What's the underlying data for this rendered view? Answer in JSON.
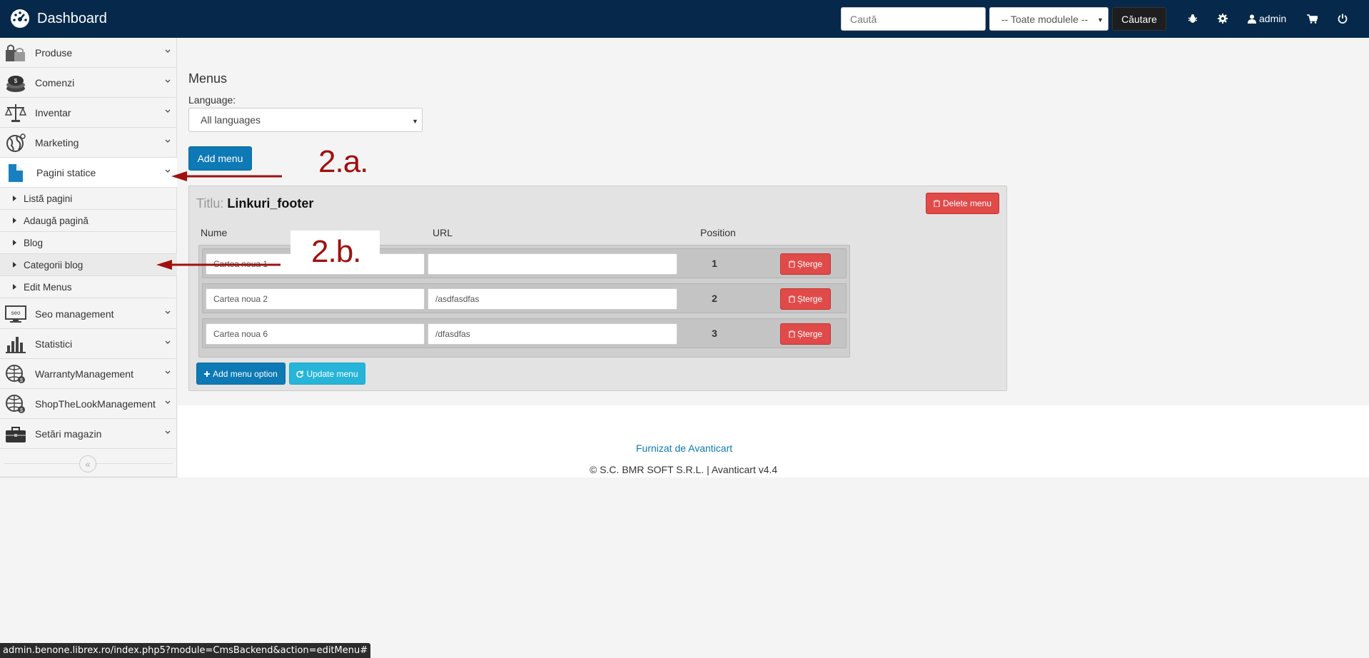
{
  "navbar": {
    "brand": "Dashboard",
    "search_placeholder": "Caută",
    "module_select": "-- Toate modulele --",
    "search_button": "Căutare",
    "user": "admin",
    "icons": [
      "bug-icon",
      "gear-icon",
      "user-icon",
      "cart-icon",
      "power-icon"
    ]
  },
  "sidebar": {
    "items": [
      {
        "label": "Produse",
        "icon": "shopping-bags-icon"
      },
      {
        "label": "Comenzi",
        "icon": "coins-icon"
      },
      {
        "label": "Inventar",
        "icon": "scale-icon"
      },
      {
        "label": "Marketing",
        "icon": "globe-icon"
      },
      {
        "label": "Pagini statice",
        "icon": "document-icon"
      },
      {
        "label": "Seo management",
        "icon": "seo-monitor-icon"
      },
      {
        "label": "Statistici",
        "icon": "bar-chart-icon"
      },
      {
        "label": "WarrantyManagement",
        "icon": "globe-dollar-icon"
      },
      {
        "label": "ShopTheLookManagement",
        "icon": "globe-dollar-icon"
      },
      {
        "label": "Setări magazin",
        "icon": "briefcase-icon"
      }
    ],
    "sub_items": [
      "Listă pagini",
      "Adaugă pagină",
      "Blog",
      "Categorii blog",
      "Edit Menus"
    ]
  },
  "main": {
    "title": "Menus",
    "language_label": "Language:",
    "language_value": "All languages",
    "add_menu": "Add menu",
    "panel": {
      "title_prefix": "Titlu:",
      "title_value": "Linkuri_footer",
      "delete_menu": "Delete menu",
      "columns": {
        "name": "Nume",
        "url": "URL",
        "position": "Position"
      },
      "rows": [
        {
          "name": "Cartea noua 1",
          "url": "",
          "position": "1"
        },
        {
          "name": "Cartea noua 2",
          "url": "/asdfasdfas",
          "position": "2"
        },
        {
          "name": "Cartea noua 6",
          "url": "/dfasdfas",
          "position": "3"
        }
      ],
      "row_delete": "Șterge",
      "add_option": "Add menu option",
      "update_menu": "Update menu"
    }
  },
  "footer": {
    "link": "Furnizat de Avanticart",
    "copyright": "© S.C. BMR SOFT S.R.L. | Avanticart v4.4"
  },
  "annotations": {
    "a": "2.a.",
    "b": "2.b.",
    "color": "#a01010"
  },
  "statusbar": "admin.benone.librex.ro/index.php5?module=CmsBackend&action=editMenu#"
}
